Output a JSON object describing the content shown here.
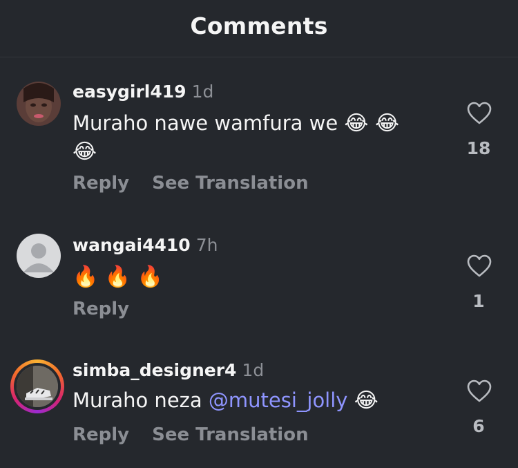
{
  "header": {
    "title": "Comments"
  },
  "comments": [
    {
      "username": "easygirl419",
      "time": "1d",
      "text": "Muraho nawe wamfura we",
      "emojis": "😂 😂",
      "emojis2": "😂",
      "reply": "Reply",
      "translate": "See Translation",
      "likes": "18"
    },
    {
      "username": "wangai4410",
      "time": "7h",
      "text": "🔥 🔥 🔥",
      "reply": "Reply",
      "likes": "1"
    },
    {
      "username": "simba_designer4",
      "time": "1d",
      "text": "Muraho neza",
      "mention": "@mutesi_jolly",
      "emojis": "😂",
      "reply": "Reply",
      "translate": "See Translation",
      "likes": "6"
    }
  ],
  "icons": {
    "like": "heart-outline-icon",
    "default_avatar": "person-icon"
  },
  "colors": {
    "background": "#25282d",
    "mention": "#8f95ff",
    "secondary": "#8b8e94"
  }
}
